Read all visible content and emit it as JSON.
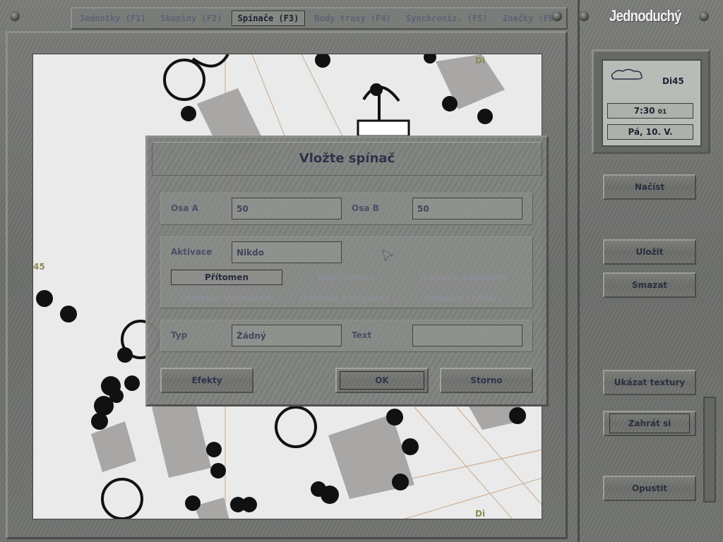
{
  "tabs": [
    {
      "label": "Jednotky (F1)",
      "active": false
    },
    {
      "label": "Skupiny (F2)",
      "active": false
    },
    {
      "label": "Spínače (F3)",
      "active": true
    },
    {
      "label": "Body trasy (F4)",
      "active": false
    },
    {
      "label": "Synchroniz. (F5)",
      "active": false
    },
    {
      "label": "Značky (F6)",
      "active": false
    }
  ],
  "sidebar": {
    "mode_title": "Jednoduchý",
    "unit_name": "Di45",
    "time": "7:30",
    "time_seconds": "01",
    "date": "Pá, 10. V.",
    "weather_icon": "cloud-icon",
    "buttons": {
      "load": "Načíst",
      "save": "Uložit",
      "delete": "Smazat",
      "show_textures": "Ukázat textury",
      "play": "Zahrát si",
      "quit": "Opustit"
    }
  },
  "map": {
    "labels": {
      "top": "Di",
      "left": "45",
      "bottom": "Di"
    }
  },
  "dialog": {
    "title": "Vložte spínač",
    "axis_a_label": "Osa A",
    "axis_a_value": "50",
    "axis_b_label": "Osa B",
    "axis_b_value": "50",
    "activation_label": "Aktivace",
    "activation_value": "Nikdo",
    "options": [
      "Přítomen",
      "Nepřítomen",
      "Odhalen Západem",
      "Odhalen Východem",
      "Odhalen partyzány",
      "Odhalen civilisty"
    ],
    "selected_option": "Přítomen",
    "type_label": "Typ",
    "type_value": "Žádný",
    "text_label": "Text",
    "text_value": "",
    "buttons": {
      "effects": "Efekty",
      "ok": "OK",
      "cancel": "Storno"
    }
  },
  "colors": {
    "panel": "#7d7f7c",
    "map_bg": "#eaeaea",
    "map_label": "#8c8a55"
  }
}
